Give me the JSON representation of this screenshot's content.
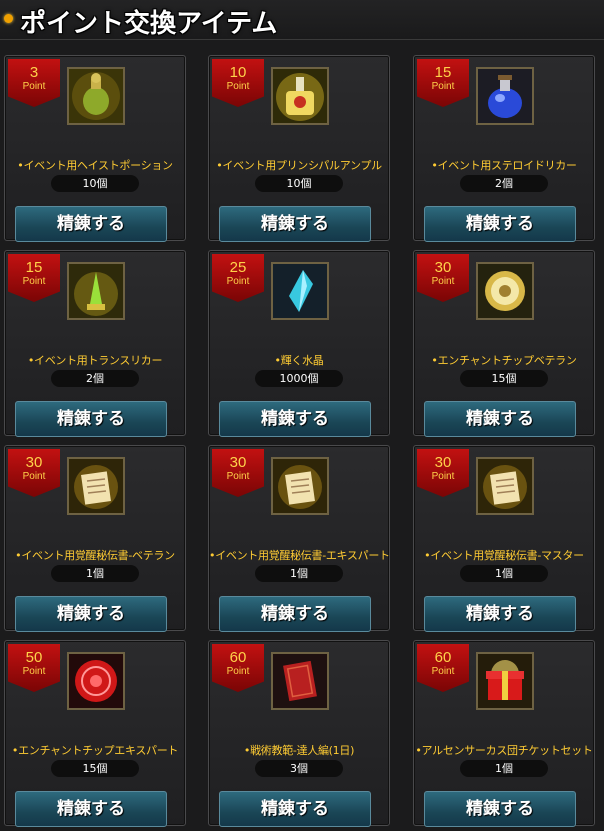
{
  "header": {
    "title": "ポイント交換アイテム"
  },
  "colors": {
    "badge": "#b00c0c",
    "item_name": "#ffcc33",
    "button": "#1f5063",
    "background": "#1b1b1c"
  },
  "items": [
    {
      "points": "3",
      "point_label": "Point",
      "name": "•イベント用ヘイストポーション",
      "qty": "10個",
      "button": "精錬する",
      "icon": "haste-potion-icon"
    },
    {
      "points": "10",
      "point_label": "Point",
      "name": "•イベント用プリンシパルアンプル",
      "qty": "10個",
      "button": "精錬する",
      "icon": "ampoule-icon"
    },
    {
      "points": "15",
      "point_label": "Point",
      "name": "•イベント用ステロイドリカー",
      "qty": "2個",
      "button": "精錬する",
      "icon": "blue-potion-icon"
    },
    {
      "points": "15",
      "point_label": "Point",
      "name": "•イベント用トランスリカー",
      "qty": "2個",
      "button": "精錬する",
      "icon": "trans-liquor-icon"
    },
    {
      "points": "25",
      "point_label": "Point",
      "name": "•輝く水晶",
      "qty": "1000個",
      "button": "精錬する",
      "icon": "crystal-icon"
    },
    {
      "points": "30",
      "point_label": "Point",
      "name": "•エンチャントチップベテラン",
      "qty": "15個",
      "button": "精錬する",
      "icon": "gold-chip-icon"
    },
    {
      "points": "30",
      "point_label": "Point",
      "name": "•イベント用覚醒秘伝書-ベテラン",
      "qty": "1個",
      "button": "精錬する",
      "icon": "scroll-icon"
    },
    {
      "points": "30",
      "point_label": "Point",
      "name": "•イベント用覚醒秘伝書-エキスパート",
      "qty": "1個",
      "button": "精錬する",
      "icon": "scroll-icon"
    },
    {
      "points": "30",
      "point_label": "Point",
      "name": "•イベント用覚醒秘伝書-マスター",
      "qty": "1個",
      "button": "精錬する",
      "icon": "scroll-icon"
    },
    {
      "points": "50",
      "point_label": "Point",
      "name": "•エンチャントチップエキスパート",
      "qty": "15個",
      "button": "精錬する",
      "icon": "red-chip-icon"
    },
    {
      "points": "60",
      "point_label": "Point",
      "name": "•戦術教範-達人編(1日)",
      "qty": "3個",
      "button": "精錬する",
      "icon": "book-icon"
    },
    {
      "points": "60",
      "point_label": "Point",
      "name": "•アルセンサーカス団チケットセット",
      "qty": "1個",
      "button": "精錬する",
      "icon": "gift-box-icon"
    }
  ]
}
